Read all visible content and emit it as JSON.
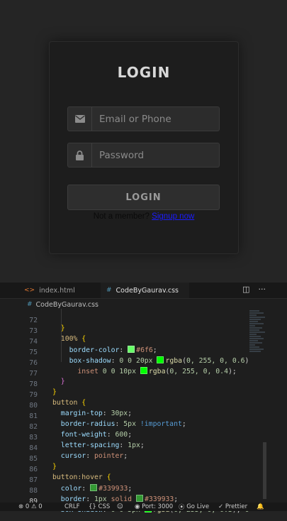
{
  "login": {
    "title": "LOGIN",
    "email_placeholder": "Email or Phone",
    "password_placeholder": "Password",
    "button_label": "LOGIN",
    "member_text": "Not a member?",
    "signup_link": "Signup now"
  },
  "editor": {
    "tabs": [
      {
        "label": "index.html",
        "icon": "html-file-icon"
      },
      {
        "label": "CodeByGaurav.css",
        "icon": "css-file-icon",
        "active": true
      }
    ],
    "breadcrumb": "CodeByGaurav.css",
    "line_numbers": [
      "72",
      "73",
      "74",
      "75",
      "76",
      "77",
      "78",
      "79",
      "80",
      "81",
      "82",
      "83",
      "84",
      "85",
      "86",
      "87",
      "88",
      "89"
    ],
    "active_line": "89",
    "swatch_colors": {
      "green_6f6": "#66ff66",
      "rgba_green": "#00ff00",
      "green_339933": "#339933"
    }
  },
  "statusbar": {
    "problems_errors": "0",
    "problems_warnings": "0",
    "eol": "CRLF",
    "language": "CSS",
    "port": "Port: 3000",
    "go_live": "Go Live",
    "prettier": "Prettier"
  }
}
